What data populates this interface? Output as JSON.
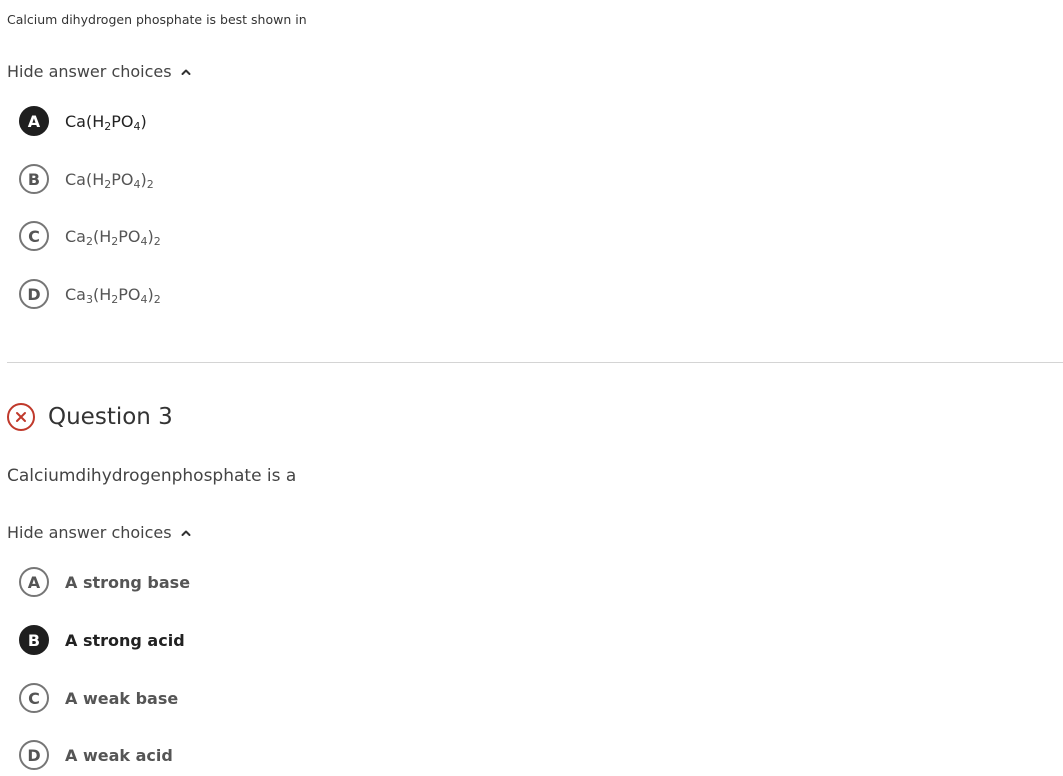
{
  "q2": {
    "prompt": "Calcium dihydrogen phosphate is best shown in",
    "toggle_label": "Hide answer choices",
    "choices": [
      {
        "letter": "A",
        "selected": true,
        "formula": [
          "Ca(H",
          "2",
          "PO",
          "4",
          ")",
          "",
          ""
        ]
      },
      {
        "letter": "B",
        "selected": false,
        "formula": [
          "Ca(H",
          "2",
          "PO",
          "4",
          ")",
          "2",
          ""
        ]
      },
      {
        "letter": "C",
        "selected": false,
        "formula": [
          "Ca",
          "2",
          "(H",
          "2",
          "PO",
          "4",
          ")",
          "2"
        ]
      },
      {
        "letter": "D",
        "selected": false,
        "formula": [
          "Ca",
          "3",
          "(H",
          "2",
          "PO",
          "4",
          ")",
          "2"
        ]
      }
    ]
  },
  "q3": {
    "status_icon": "x-circle-icon",
    "status_color": "#c0392b",
    "title": "Question 3",
    "prompt": "Calciumdihydrogenphosphate is a",
    "toggle_label": "Hide answer choices",
    "choices": [
      {
        "letter": "A",
        "label": "A strong base",
        "selected": false
      },
      {
        "letter": "B",
        "label": "A strong acid",
        "selected": true
      },
      {
        "letter": "C",
        "label": "A weak base",
        "selected": false
      },
      {
        "letter": "D",
        "label": "A weak acid",
        "selected": false
      }
    ]
  },
  "colors": {
    "selected_badge": "#1f1f1f",
    "unselected_badge_border": "#767676",
    "divider": "#d4d4d4"
  }
}
